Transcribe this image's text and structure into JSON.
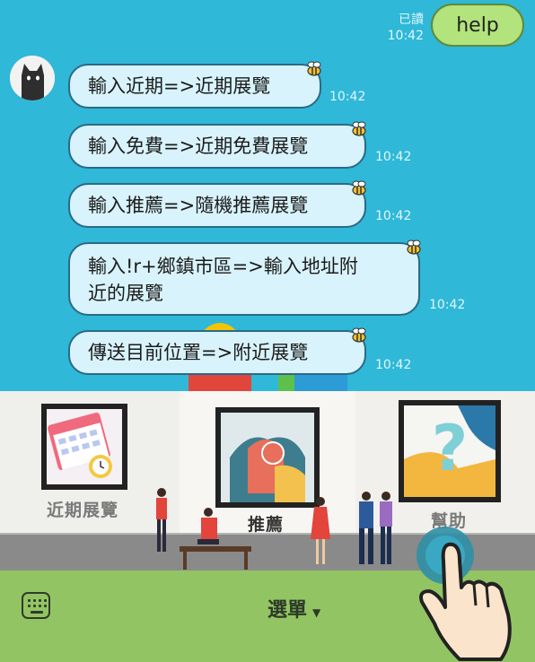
{
  "chat": {
    "sent": {
      "text": "help",
      "read_status": "已讀",
      "time": "10:42"
    },
    "received": [
      {
        "lines": [
          "輸入近期=>近期展覽"
        ],
        "time": "10:42"
      },
      {
        "lines": [
          "輸入免費=>近期免費展覽"
        ],
        "time": "10:42"
      },
      {
        "lines": [
          "輸入推薦=>隨機推薦展覽"
        ],
        "time": "10:42"
      },
      {
        "lines": [
          "輸入!r+鄉鎮市區=>輸入地址附",
          "近的展覽"
        ],
        "time": "10:42"
      },
      {
        "lines": [
          "傳送目前位置=>附近展覽"
        ],
        "time": "10:42"
      }
    ]
  },
  "rich_menu": {
    "items": [
      {
        "label": "近期展覽"
      },
      {
        "label": "推薦"
      },
      {
        "label": "幫助"
      }
    ]
  },
  "bottom_bar": {
    "menu_label": "選單",
    "keyboard_icon": "keyboard-icon",
    "arrow_icon": "caret-down-icon"
  },
  "colors": {
    "chat_bg": "#2fb8d8",
    "bubble": "#d8f3fb",
    "sent_bubble": "#b2e37c",
    "bottom_bar": "#93c463"
  }
}
